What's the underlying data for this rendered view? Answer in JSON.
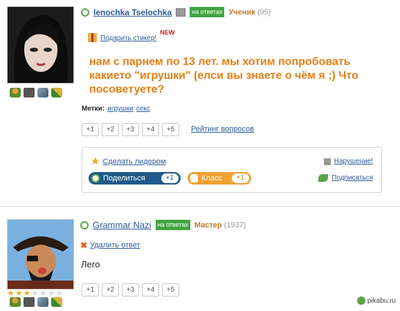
{
  "post1": {
    "user_name": "lenochka Tselochka",
    "badge": "на ответах",
    "rank": "Ученик",
    "points": "(95)",
    "sticker_label": "Подарить стикер!",
    "new_label": "NEW",
    "question": "нам с парнем по 13 лет. мы хотим попробовать какието \"игрушки\" (елси вы знаете о чём я ;) Что посоветуете?",
    "tags_label": "Метки:",
    "tags": [
      "игрушки",
      "секс"
    ],
    "votes": [
      "+1",
      "+2",
      "+3",
      "+4",
      "+5"
    ],
    "rating_link": "Рейтинг вопросов",
    "leader_label": "Сделать лидером",
    "share_label": "Поделиться",
    "share_count": "+1",
    "class_label": "Класс",
    "class_count": "+1",
    "violation_label": "Нарушение!",
    "subscribe_label": "Подписаться"
  },
  "post2": {
    "user_name": "Grammar Nazi",
    "badge": "на ответах",
    "rank": "Мастер",
    "points": "(1937)",
    "delete_label": "Удалить ответ",
    "answer": "Лего",
    "votes": [
      "+1",
      "+2",
      "+3",
      "+4",
      "+5"
    ],
    "stars_filled": 3,
    "stars_total": 7
  },
  "watermark": "pikabu.ru",
  "colors": {
    "question": "#e57f16",
    "link": "#2a5a9a",
    "badge": "#41a540",
    "share": "#1f5a8a",
    "class": "#f0a030"
  }
}
